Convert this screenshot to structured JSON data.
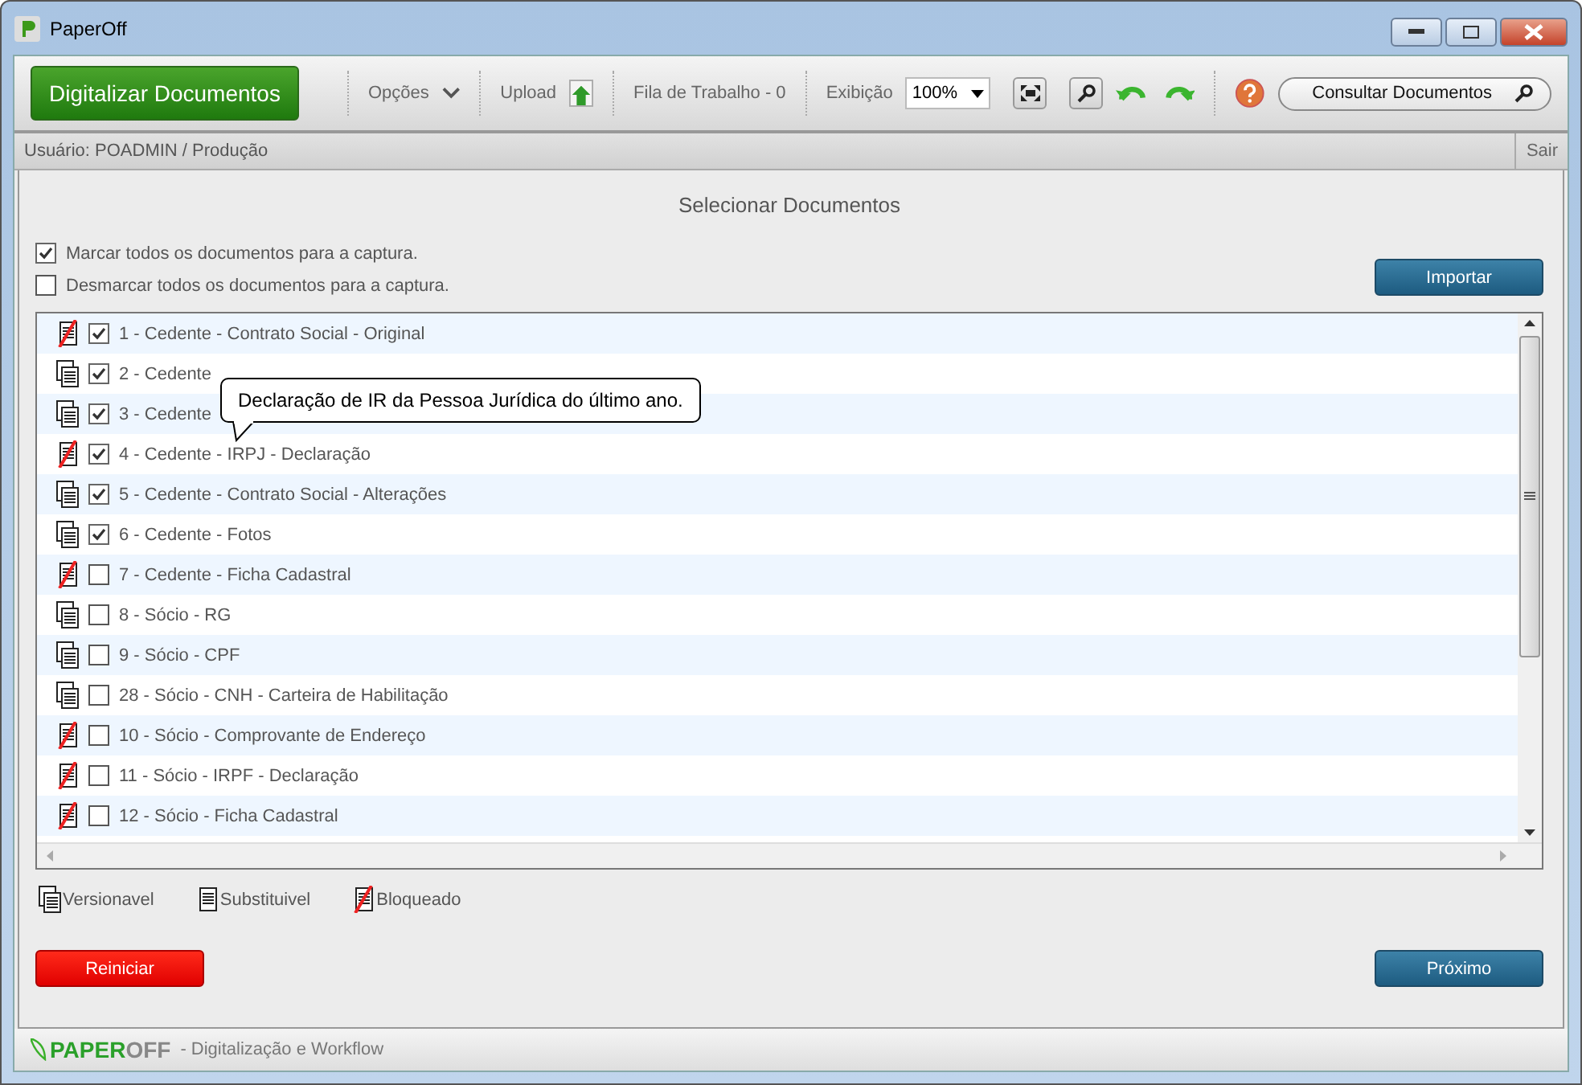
{
  "window": {
    "title": "PaperOff"
  },
  "toolbar": {
    "primary_button": "Digitalizar Documentos",
    "options": "Opções",
    "upload": "Upload",
    "queue": "Fila de Trabalho - 0",
    "zoom_label": "Exibição",
    "zoom_value": "100%",
    "search_button": "Consultar Documentos"
  },
  "user_bar": {
    "user": "Usuário: POADMIN / Produção",
    "logout": "Sair"
  },
  "heading": "Selecionar Documentos",
  "select_all": [
    {
      "label": "Marcar todos os documentos para a captura.",
      "checked": true
    },
    {
      "label": "Desmarcar todos os documentos para a captura.",
      "checked": false
    }
  ],
  "import_button": "Importar",
  "documents": [
    {
      "kind": "bloqueado",
      "checked": true,
      "label": "1 - Cedente - Contrato Social - Original"
    },
    {
      "kind": "versionavel",
      "checked": true,
      "label": "2 - Cedente"
    },
    {
      "kind": "versionavel",
      "checked": true,
      "label": "3 - Cedente"
    },
    {
      "kind": "bloqueado",
      "checked": true,
      "label": "4 - Cedente - IRPJ - Declaração"
    },
    {
      "kind": "versionavel",
      "checked": true,
      "label": "5 - Cedente - Contrato Social - Alterações"
    },
    {
      "kind": "versionavel",
      "checked": true,
      "label": "6 - Cedente - Fotos"
    },
    {
      "kind": "bloqueado",
      "checked": false,
      "label": "7 - Cedente - Ficha Cadastral"
    },
    {
      "kind": "versionavel",
      "checked": false,
      "label": "8 - Sócio - RG"
    },
    {
      "kind": "versionavel",
      "checked": false,
      "label": "9 - Sócio - CPF"
    },
    {
      "kind": "versionavel",
      "checked": false,
      "label": "28 - Sócio - CNH - Carteira de Habilitação"
    },
    {
      "kind": "bloqueado",
      "checked": false,
      "label": "10 - Sócio - Comprovante de Endereço"
    },
    {
      "kind": "bloqueado",
      "checked": false,
      "label": "11 - Sócio - IRPF - Declaração"
    },
    {
      "kind": "bloqueado",
      "checked": false,
      "label": "12 - Sócio - Ficha Cadastral"
    }
  ],
  "tooltip": "Declaração de IR da Pessoa Jurídica do último ano.",
  "legend": [
    {
      "kind": "versionavel",
      "label": "Versionavel"
    },
    {
      "kind": "substituivel",
      "label": "Substituivel"
    },
    {
      "kind": "bloqueado",
      "label": "Bloqueado"
    }
  ],
  "reset_button": "Reiniciar",
  "next_button": "Próximo",
  "footer": {
    "logo_green": "PAPER",
    "logo_grey": "OFF",
    "tagline": "- Digitalização e Workflow"
  }
}
